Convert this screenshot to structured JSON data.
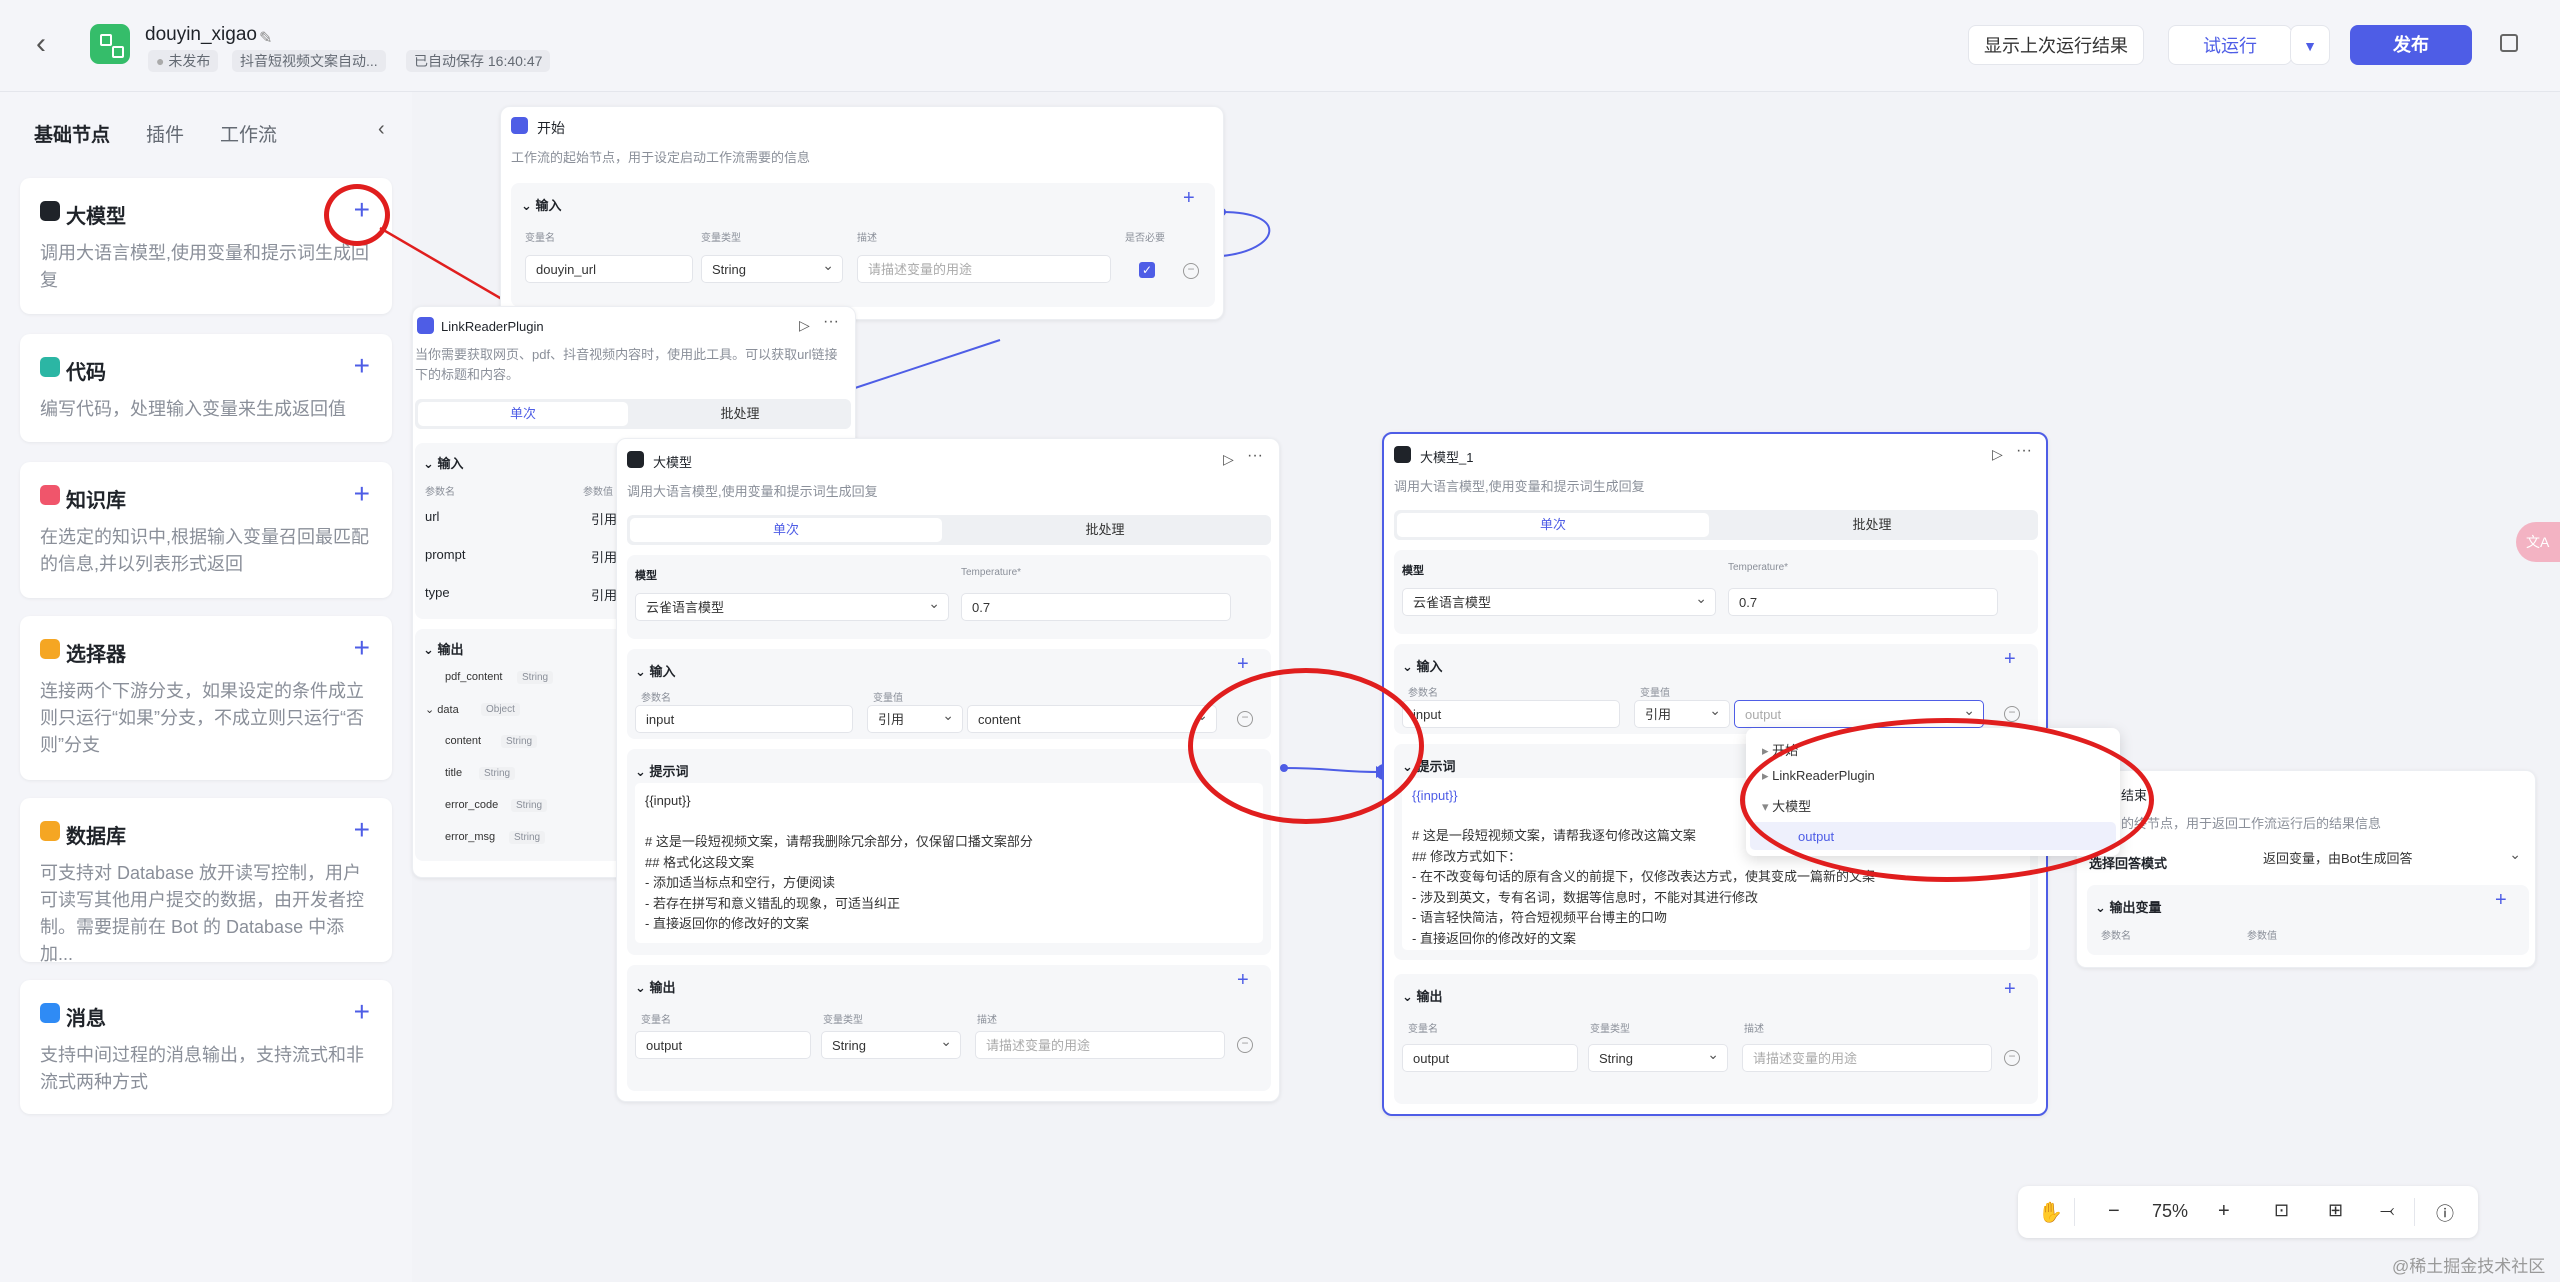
{
  "header": {
    "app_name": "douyin_xigao",
    "status": "未发布",
    "description": "抖音短视频文案自动...",
    "autosave": "已自动保存 16:40:47",
    "show_last_result": "显示上次运行结果",
    "trial_run": "试运行",
    "publish": "发布"
  },
  "sidebar": {
    "tabs": [
      "基础节点",
      "插件",
      "工作流"
    ],
    "cards": [
      {
        "name": "大模型",
        "desc": "调用大语言模型,使用变量和提示词生成回复",
        "color": "#1f2329"
      },
      {
        "name": "代码",
        "desc": "编写代码，处理输入变量来生成返回值",
        "color": "#2bb6a4"
      },
      {
        "name": "知识库",
        "desc": "在选定的知识中,根据输入变量召回最匹配的信息,并以列表形式返回",
        "color": "#f0556b"
      },
      {
        "name": "选择器",
        "desc": "连接两个下游分支，如果设定的条件成立则只运行“如果”分支，不成立则只运行“否则”分支",
        "color": "#f5a623"
      },
      {
        "name": "数据库",
        "desc": "可支持对 Database 放开读写控制，用户可读写其他用户提交的数据，由开发者控制。需要提前在 Bot 的 Database 中添加...",
        "color": "#f5a623"
      },
      {
        "name": "消息",
        "desc": "支持中间过程的消息输出，支持流式和非流式两种方式",
        "color": "#2f8bf5"
      }
    ]
  },
  "start_node": {
    "title": "开始",
    "desc": "工作流的起始节点，用于设定启动工作流需要的信息",
    "input_label": "输入",
    "col_name": "变量名",
    "col_type": "变量类型",
    "col_desc": "描述",
    "col_required": "是否必要",
    "var_name": "douyin_url",
    "var_type": "String",
    "var_placeholder": "请描述变量的用途"
  },
  "link_node": {
    "title": "LinkReaderPlugin",
    "desc": "当你需要获取网页、pdf、抖音视频内容时，使用此工具。可以获取url链接下的标题和内容。",
    "tab_single": "单次",
    "tab_batch": "批处理",
    "input_label": "输入",
    "col_param": "参数名",
    "col_value": "参数值",
    "params": [
      "url",
      "prompt",
      "type"
    ],
    "ref": "引用",
    "output_label": "输出",
    "outputs": [
      {
        "name": "pdf_content",
        "type": "String"
      },
      {
        "name": "data",
        "type": "Object"
      },
      {
        "name": "content",
        "type": "String"
      },
      {
        "name": "title",
        "type": "String"
      },
      {
        "name": "error_code",
        "type": "String"
      },
      {
        "name": "error_msg",
        "type": "String"
      }
    ]
  },
  "llm_node": {
    "title": "大模型",
    "desc": "调用大语言模型,使用变量和提示词生成回复",
    "tab_single": "单次",
    "tab_batch": "批处理",
    "model_label": "模型",
    "model": "云雀语言模型",
    "temp_label": "Temperature*",
    "temp": "0.7",
    "input_label": "输入",
    "col_param": "参数名",
    "col_value": "变量值",
    "param": "input",
    "ref": "引用",
    "value": "content",
    "prompt_label": "提示词",
    "prompt": "{{input}}\n\n# 这是一段短视频文案，请帮我删除冗余部分，仅保留口播文案部分\n## 格式化这段文案\n- 添加适当标点和空行，方便阅读\n- 若存在拼写和意义错乱的现象，可适当纠正\n- 直接返回你的修改好的文案",
    "output_label": "输出",
    "col_name": "变量名",
    "col_type": "变量类型",
    "col_desc": "描述",
    "out_name": "output",
    "out_type": "String",
    "out_placeholder": "请描述变量的用途"
  },
  "llm_node_1": {
    "title": "大模型_1",
    "desc": "调用大语言模型,使用变量和提示词生成回复",
    "tab_single": "单次",
    "tab_batch": "批处理",
    "model_label": "模型",
    "model": "云雀语言模型",
    "temp_label": "Temperature*",
    "temp": "0.7",
    "input_label": "输入",
    "col_param": "参数名",
    "col_value": "变量值",
    "param": "input",
    "ref": "引用",
    "value_placeholder": "output",
    "prompt_label": "提示词",
    "prompt_first": "{{input}}",
    "prompt": "# 这是一段短视频文案，请帮我逐句修改这篇文案\n## 修改方式如下：\n- 在不改变每句话的原有含义的前提下，仅修改表达方式，使其变成一篇新的文案\n- 涉及到英文，专有名词，数据等信息时，不能对其进行修改\n- 语言轻快简洁，符合短视频平台博主的口吻\n- 直接返回你的修改好的文案",
    "output_label": "输出",
    "col_name": "变量名",
    "col_type": "变量类型",
    "col_desc": "描述",
    "out_name": "output",
    "out_type": "String",
    "out_placeholder": "请描述变量的用途"
  },
  "dropdown": {
    "items": [
      "开始",
      "LinkReaderPlugin",
      "大模型"
    ],
    "sub_item": "output"
  },
  "end_node": {
    "title": "结束",
    "desc": "的终节点，用于返回工作流运行后的结果信息",
    "mode_label": "选择回答模式",
    "mode_value": "返回变量，由Bot生成回答",
    "output_label": "输出变量",
    "col_param": "参数名",
    "col_value": "参数值"
  },
  "zoom": {
    "level": "75%"
  },
  "watermark": "@稀土掘金技术社区"
}
